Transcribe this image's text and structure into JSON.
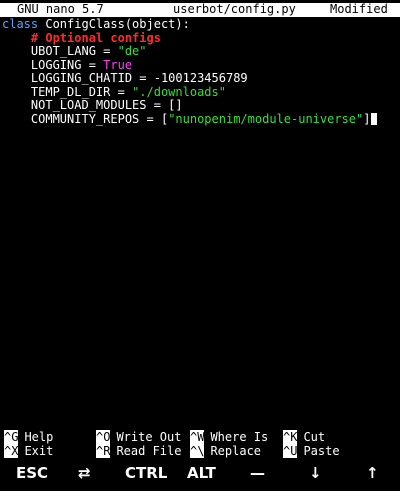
{
  "titlebar": {
    "app": "GNU nano 5.7",
    "file": "userbot/config.py",
    "status": "Modified"
  },
  "code": {
    "l1_kw": "class",
    "l1_rest": " ConfigClass(object):",
    "l2_comment": "# Optional configs",
    "l3_name": "UBOT_LANG = ",
    "l3_val": "\"de\"",
    "l4_name": "LOGGING = ",
    "l4_val": "True",
    "l5": "LOGGING_CHATID = -100123456789",
    "l6_name": "TEMP_DL_DIR = ",
    "l6_val": "\"./downloads\"",
    "l7": "NOT_LOAD_MODULES = []",
    "l8_name": "COMMUNITY_REPOS = [",
    "l8_val": "\"nunopenim/module-universe\"",
    "l8_end": "]"
  },
  "shortcuts": [
    {
      "key": "^G",
      "label": "Help"
    },
    {
      "key": "^X",
      "label": "Exit"
    },
    {
      "key": "^O",
      "label": "Write Out"
    },
    {
      "key": "^R",
      "label": "Read File"
    },
    {
      "key": "^W",
      "label": "Where Is"
    },
    {
      "key": "^\\",
      "label": "Replace"
    },
    {
      "key": "^K",
      "label": "Cut"
    },
    {
      "key": "^U",
      "label": "Paste"
    }
  ],
  "keybar": {
    "esc": "ESC",
    "tab": "⇄",
    "ctrl": "CTRL",
    "alt": "ALT",
    "dash": "—",
    "down": "↓",
    "up": "↑"
  }
}
